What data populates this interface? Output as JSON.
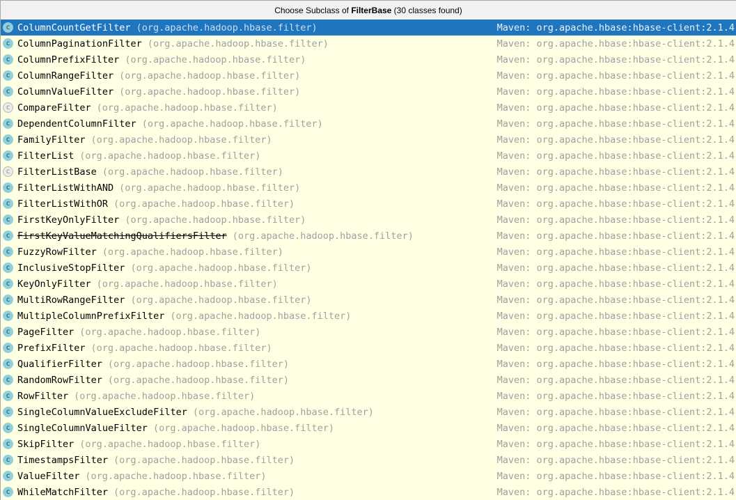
{
  "popup": {
    "title": {
      "prefix": "Choose Subclass of ",
      "highlight": "FilterBase",
      "suffix": " (30 classes found)"
    },
    "classes_found": 30,
    "package_label": "(org.apache.hadoop.hbase.filter)",
    "origin_label": "Maven: org.apache.hbase:hbase-client:2.1.4",
    "icons": {
      "class_icon_glyph": "c",
      "abstract_class_icon_glyph": "c"
    },
    "colors": {
      "selection_bg": "#2076BE",
      "list_bg": "#FFFFE4",
      "titlebar_bg": "#F2F2F2",
      "class_icon_fill": "#8FD0DC",
      "muted_text": "#A0A0A0",
      "name_text": "#000000"
    },
    "classes": [
      {
        "name": "ColumnCountGetFilter",
        "selected": true,
        "abstract": false,
        "deprecated": false
      },
      {
        "name": "ColumnPaginationFilter",
        "selected": false,
        "abstract": false,
        "deprecated": false
      },
      {
        "name": "ColumnPrefixFilter",
        "selected": false,
        "abstract": false,
        "deprecated": false
      },
      {
        "name": "ColumnRangeFilter",
        "selected": false,
        "abstract": false,
        "deprecated": false
      },
      {
        "name": "ColumnValueFilter",
        "selected": false,
        "abstract": false,
        "deprecated": false
      },
      {
        "name": "CompareFilter",
        "selected": false,
        "abstract": true,
        "deprecated": false
      },
      {
        "name": "DependentColumnFilter",
        "selected": false,
        "abstract": false,
        "deprecated": false
      },
      {
        "name": "FamilyFilter",
        "selected": false,
        "abstract": false,
        "deprecated": false
      },
      {
        "name": "FilterList",
        "selected": false,
        "abstract": false,
        "deprecated": false
      },
      {
        "name": "FilterListBase",
        "selected": false,
        "abstract": true,
        "deprecated": false
      },
      {
        "name": "FilterListWithAND",
        "selected": false,
        "abstract": false,
        "deprecated": false
      },
      {
        "name": "FilterListWithOR",
        "selected": false,
        "abstract": false,
        "deprecated": false
      },
      {
        "name": "FirstKeyOnlyFilter",
        "selected": false,
        "abstract": false,
        "deprecated": false
      },
      {
        "name": "FirstKeyValueMatchingQualifiersFilter",
        "selected": false,
        "abstract": false,
        "deprecated": true
      },
      {
        "name": "FuzzyRowFilter",
        "selected": false,
        "abstract": false,
        "deprecated": false
      },
      {
        "name": "InclusiveStopFilter",
        "selected": false,
        "abstract": false,
        "deprecated": false
      },
      {
        "name": "KeyOnlyFilter",
        "selected": false,
        "abstract": false,
        "deprecated": false
      },
      {
        "name": "MultiRowRangeFilter",
        "selected": false,
        "abstract": false,
        "deprecated": false
      },
      {
        "name": "MultipleColumnPrefixFilter",
        "selected": false,
        "abstract": false,
        "deprecated": false
      },
      {
        "name": "PageFilter",
        "selected": false,
        "abstract": false,
        "deprecated": false
      },
      {
        "name": "PrefixFilter",
        "selected": false,
        "abstract": false,
        "deprecated": false
      },
      {
        "name": "QualifierFilter",
        "selected": false,
        "abstract": false,
        "deprecated": false
      },
      {
        "name": "RandomRowFilter",
        "selected": false,
        "abstract": false,
        "deprecated": false
      },
      {
        "name": "RowFilter",
        "selected": false,
        "abstract": false,
        "deprecated": false
      },
      {
        "name": "SingleColumnValueExcludeFilter",
        "selected": false,
        "abstract": false,
        "deprecated": false
      },
      {
        "name": "SingleColumnValueFilter",
        "selected": false,
        "abstract": false,
        "deprecated": false
      },
      {
        "name": "SkipFilter",
        "selected": false,
        "abstract": false,
        "deprecated": false
      },
      {
        "name": "TimestampsFilter",
        "selected": false,
        "abstract": false,
        "deprecated": false
      },
      {
        "name": "ValueFilter",
        "selected": false,
        "abstract": false,
        "deprecated": false
      },
      {
        "name": "WhileMatchFilter",
        "selected": false,
        "abstract": false,
        "deprecated": false
      }
    ]
  }
}
